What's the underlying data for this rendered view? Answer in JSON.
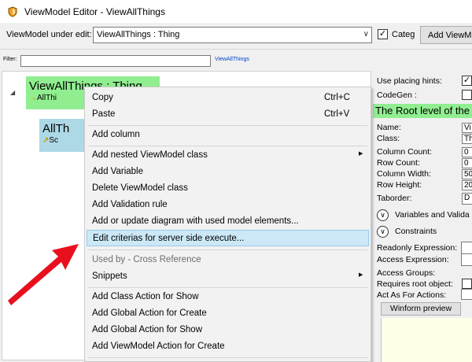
{
  "window": {
    "title": "ViewModel Editor - ViewAllThings",
    "icon": "shield-logo-icon"
  },
  "toolbar": {
    "vm_label": "ViewModel under edit:",
    "vm_value": "ViewAllThings : Thing",
    "categ_label": "Categ",
    "categ_checked": "✓",
    "add_vm_label": "Add ViewM"
  },
  "filter": {
    "label": "Filter:",
    "value": "",
    "link": "ViewAllThings"
  },
  "tree": {
    "root": {
      "title": "ViewAllThings : Thing",
      "sub": "AllThi"
    },
    "child": {
      "title": "AllTh",
      "sub": "Sc"
    }
  },
  "right_panel": {
    "use_placing_hints": "Use placing hints:",
    "use_placing_hints_checked": "✓",
    "codegen": "CodeGen :",
    "banner": "The Root level of the",
    "fields": [
      {
        "label": "Name:",
        "value": "Vi"
      },
      {
        "label": "Class:",
        "value": "Th"
      },
      {
        "label": "Column Count:",
        "value": "0"
      },
      {
        "label": "Row Count:",
        "value": "0"
      },
      {
        "label": "Column Width:",
        "value": "50"
      },
      {
        "label": "Row Height:",
        "value": "20"
      },
      {
        "label": "Taborder:",
        "value": "D"
      }
    ],
    "variables_label": "Variables and Valida",
    "constraints_label": "Constraints",
    "readonly_expr": "Readonly Expression:",
    "access_expr": "Access Expression:",
    "access_groups": "Access Groups:",
    "requires_root": "Requires root object:",
    "act_as_for_actions": "Act As For Actions:",
    "winform_preview": "Winform preview"
  },
  "context_menu": {
    "items": [
      {
        "label": "Copy",
        "shortcut": "Ctrl+C"
      },
      {
        "label": "Paste",
        "shortcut": "Ctrl+V"
      },
      {
        "label": "Add column"
      },
      {
        "label": "Add nested ViewModel class"
      },
      {
        "label": "Add Variable"
      },
      {
        "label": "Delete ViewModel class"
      },
      {
        "label": "Add Validation rule"
      },
      {
        "label": "Add or update diagram with used model elements..."
      },
      {
        "label": "Edit criterias for server side execute..."
      },
      {
        "label": "Used by - Cross Reference"
      },
      {
        "label": "Snippets"
      },
      {
        "label": "Add Class Action for Show"
      },
      {
        "label": "Add Global Action for Create"
      },
      {
        "label": "Add Global Action for Show"
      },
      {
        "label": "Add ViewModel Action for Create"
      }
    ]
  },
  "colors": {
    "root_node": "#90ee90",
    "child_node": "#add8e6",
    "highlight": "#cce8f6",
    "annotation_arrow": "#e8101e"
  }
}
